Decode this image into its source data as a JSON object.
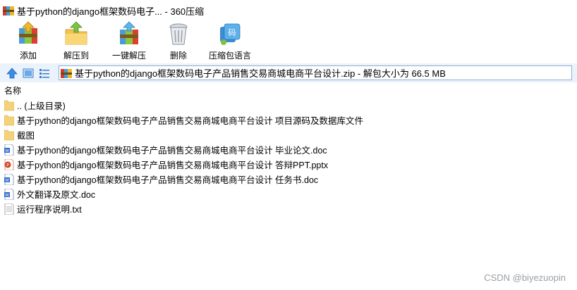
{
  "window": {
    "title": "基于python的django框架数码电子... - 360压缩"
  },
  "toolbar": {
    "items": [
      {
        "label": "添加",
        "icon": "add-archive-icon"
      },
      {
        "label": "解压到",
        "icon": "extract-to-icon"
      },
      {
        "label": "一键解压",
        "icon": "one-click-extract-icon"
      },
      {
        "label": "删除",
        "icon": "delete-trash-icon"
      },
      {
        "label": "压缩包语言",
        "icon": "archive-language-icon"
      }
    ]
  },
  "address": {
    "path": "基于python的django框架数码电子产品销售交易商城电商平台设计.zip - 解包大小为 66.5 MB"
  },
  "list": {
    "column_name": "名称",
    "rows": [
      {
        "name": ".. (上级目录)",
        "type": "folder"
      },
      {
        "name": "基于python的django框架数码电子产品销售交易商城电商平台设计 项目源码及数据库文件",
        "type": "folder"
      },
      {
        "name": "截图",
        "type": "folder"
      },
      {
        "name": "基于python的django框架数码电子产品销售交易商城电商平台设计 毕业论文.doc",
        "type": "doc"
      },
      {
        "name": "基于python的django框架数码电子产品销售交易商城电商平台设计 答辩PPT.pptx",
        "type": "pptx"
      },
      {
        "name": "基于python的django框架数码电子产品销售交易商城电商平台设计 任务书.doc",
        "type": "doc"
      },
      {
        "name": "外文翻译及原文.doc",
        "type": "doc"
      },
      {
        "name": "运行程序说明.txt",
        "type": "txt"
      }
    ]
  },
  "watermark": "CSDN @biyezuopin",
  "colors": {
    "folder": "#f5d27a",
    "doc": "#2b66c9",
    "pptx": "#d24726",
    "address_bar_bg": "#eaf3fc"
  }
}
